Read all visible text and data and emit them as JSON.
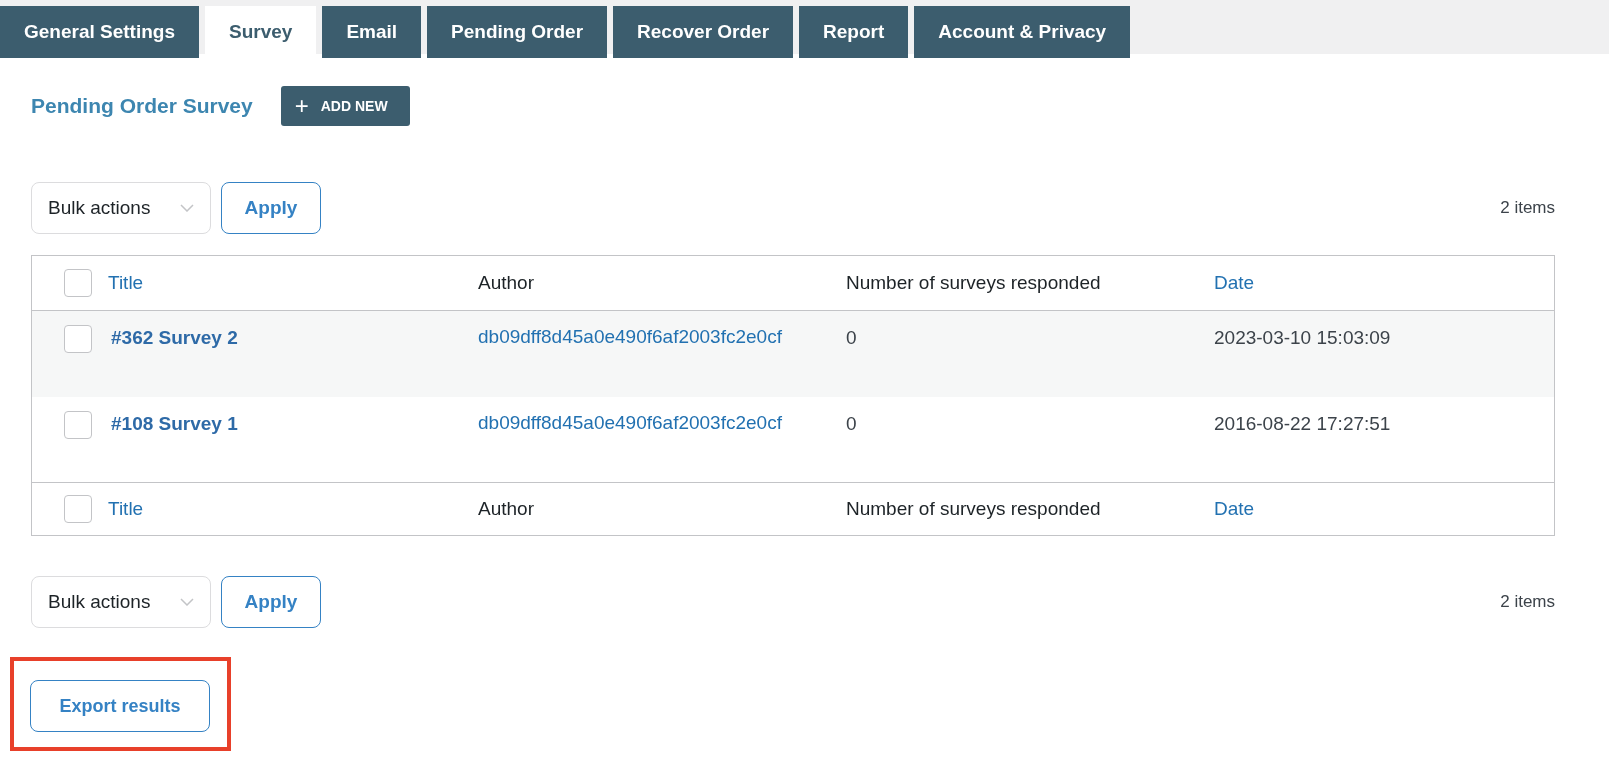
{
  "tabs": [
    {
      "label": "General Settings",
      "selected": false
    },
    {
      "label": "Survey",
      "selected": true
    },
    {
      "label": "Email",
      "selected": false
    },
    {
      "label": "Pending Order",
      "selected": false
    },
    {
      "label": "Recover Order",
      "selected": false
    },
    {
      "label": "Report",
      "selected": false
    },
    {
      "label": "Account & Privacy",
      "selected": false
    }
  ],
  "heading": "Pending Order Survey",
  "add_button": {
    "icon": "+",
    "label": "ADD NEW"
  },
  "top_nav": {
    "bulk_actions": "Bulk actions",
    "apply": "Apply",
    "count": "2 items"
  },
  "table": {
    "columns": [
      {
        "label": "Title",
        "sortable": true
      },
      {
        "label": "Author",
        "sortable": false
      },
      {
        "label": "Number of surveys responded",
        "sortable": false
      },
      {
        "label": "Date",
        "sortable": true
      }
    ],
    "header_checked": false,
    "rows": [
      {
        "checked": false,
        "title": "#362 Survey 2",
        "author": "db09dff8d45a0e490f6af2003fc2e0cf",
        "responses": "0",
        "date": "2023-03-10 15:03:09"
      },
      {
        "checked": false,
        "title": "#108 Survey 1",
        "author": "db09dff8d45a0e490f6af2003fc2e0cf",
        "responses": "0",
        "date": "2016-08-22 17:27:51"
      }
    ],
    "footer_checked": false,
    "footer_columns": [
      {
        "label": "Title",
        "sortable": true
      },
      {
        "label": "Author",
        "sortable": false
      },
      {
        "label": "Number of surveys responded",
        "sortable": false
      },
      {
        "label": "Date",
        "sortable": true
      }
    ]
  },
  "bottom_nav": {
    "bulk_actions": "Bulk actions",
    "apply": "Apply",
    "count": "2 items"
  },
  "export_button": {
    "label": "Export results",
    "highlighted": true
  }
}
